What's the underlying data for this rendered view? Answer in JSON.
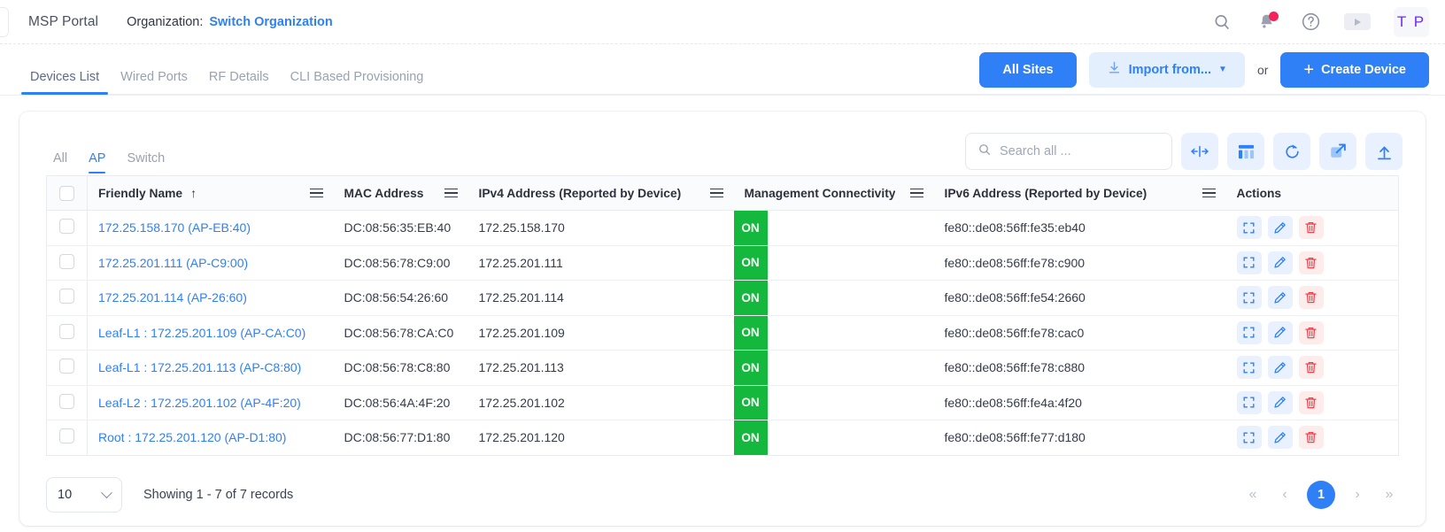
{
  "topbar": {
    "brand": "MSP Portal",
    "org_label": "Organization:",
    "org_link": "Switch Organization",
    "icons": {
      "search": "search-icon",
      "notifications": "bell-icon",
      "help": "help-circle-icon",
      "video": "play-icon"
    },
    "avatar_initials": "T P"
  },
  "nav": {
    "tabs": [
      {
        "label": "Devices List",
        "active": true
      },
      {
        "label": "Wired Ports",
        "active": false
      },
      {
        "label": "RF Details",
        "active": false
      },
      {
        "label": "CLI Based Provisioning",
        "active": false
      }
    ],
    "all_sites_label": "All Sites",
    "import_label": "Import from...",
    "or_label": "or",
    "create_label": "Create Device"
  },
  "card": {
    "filters": [
      {
        "label": "All",
        "active": false
      },
      {
        "label": "AP",
        "active": true
      },
      {
        "label": "Switch",
        "active": false
      }
    ],
    "search": {
      "placeholder": "Search all ...",
      "value": ""
    },
    "tools": [
      {
        "name": "fit-columns-icon"
      },
      {
        "name": "columns-icon"
      },
      {
        "name": "refresh-icon"
      },
      {
        "name": "open-external-icon"
      },
      {
        "name": "upload-icon"
      }
    ]
  },
  "table": {
    "columns": [
      {
        "label": "Friendly Name",
        "sorted": "asc",
        "menu": true
      },
      {
        "label": "MAC Address",
        "menu": true
      },
      {
        "label": "IPv4 Address (Reported by Device)",
        "menu": true
      },
      {
        "label": "Management Connectivity",
        "menu": true
      },
      {
        "label": "IPv6 Address (Reported by Device)",
        "menu": true
      },
      {
        "label": "Actions",
        "menu": false
      }
    ],
    "sort_arrow": "↑",
    "rows": [
      {
        "name": "172.25.158.170 (AP-EB:40)",
        "mac": "DC:08:56:35:EB:40",
        "ipv4": "172.25.158.170",
        "status": "ON",
        "ipv6": "fe80::de08:56ff:fe35:eb40"
      },
      {
        "name": "172.25.201.111 (AP-C9:00)",
        "mac": "DC:08:56:78:C9:00",
        "ipv4": "172.25.201.111",
        "status": "ON",
        "ipv6": "fe80::de08:56ff:fe78:c900"
      },
      {
        "name": "172.25.201.114 (AP-26:60)",
        "mac": "DC:08:56:54:26:60",
        "ipv4": "172.25.201.114",
        "status": "ON",
        "ipv6": "fe80::de08:56ff:fe54:2660"
      },
      {
        "name": "Leaf-L1 : 172.25.201.109 (AP-CA:C0)",
        "mac": "DC:08:56:78:CA:C0",
        "ipv4": "172.25.201.109",
        "status": "ON",
        "ipv6": "fe80::de08:56ff:fe78:cac0"
      },
      {
        "name": "Leaf-L1 : 172.25.201.113 (AP-C8:80)",
        "mac": "DC:08:56:78:C8:80",
        "ipv4": "172.25.201.113",
        "status": "ON",
        "ipv6": "fe80::de08:56ff:fe78:c880"
      },
      {
        "name": "Leaf-L2 : 172.25.201.102 (AP-4F:20)",
        "mac": "DC:08:56:4A:4F:20",
        "ipv4": "172.25.201.102",
        "status": "ON",
        "ipv6": "fe80::de08:56ff:fe4a:4f20"
      },
      {
        "name": "Root : 172.25.201.120 (AP-D1:80)",
        "mac": "DC:08:56:77:D1:80",
        "ipv4": "172.25.201.120",
        "status": "ON",
        "ipv6": "fe80::de08:56ff:fe77:d180"
      }
    ],
    "row_actions": [
      {
        "name": "expand-icon"
      },
      {
        "name": "edit-pencil-icon"
      },
      {
        "name": "delete-trash-icon"
      }
    ]
  },
  "footer": {
    "page_size": "10",
    "showing": "Showing 1 - 7 of 7 records",
    "pagination": {
      "first": "«",
      "prev": "‹",
      "current": "1",
      "next": "›",
      "last": "»"
    }
  },
  "colors": {
    "accent": "#2f80f7",
    "status_on": "#14b83c",
    "danger": "#f5225c",
    "avatar_text": "#6c2bf5"
  }
}
